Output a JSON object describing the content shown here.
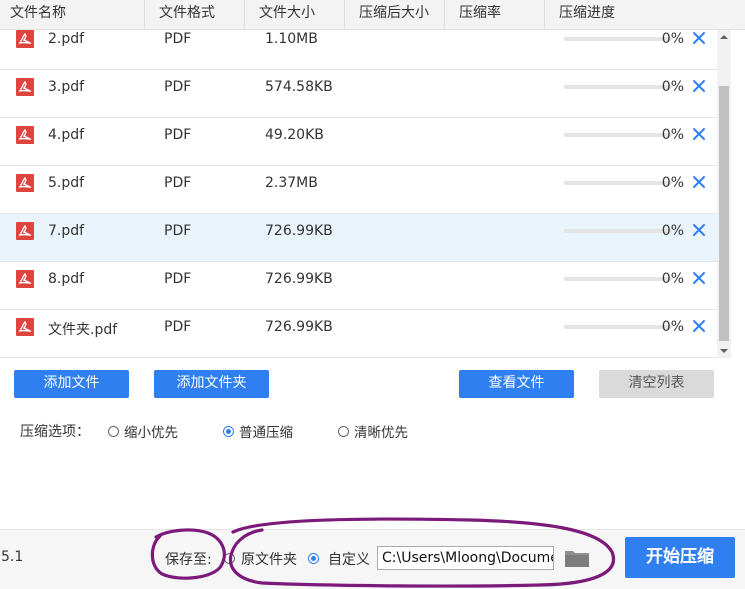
{
  "table": {
    "columns": [
      "文件名称",
      "文件格式",
      "文件大小",
      "压缩后大小",
      "压缩率",
      "压缩进度"
    ],
    "rows": [
      {
        "name": "2.pdf",
        "format": "PDF",
        "size": "1.10MB",
        "compressed_size": "",
        "ratio": "",
        "progress": 0,
        "progress_text": "0%"
      },
      {
        "name": "3.pdf",
        "format": "PDF",
        "size": "574.58KB",
        "compressed_size": "",
        "ratio": "",
        "progress": 0,
        "progress_text": "0%"
      },
      {
        "name": "4.pdf",
        "format": "PDF",
        "size": "49.20KB",
        "compressed_size": "",
        "ratio": "",
        "progress": 0,
        "progress_text": "0%"
      },
      {
        "name": "5.pdf",
        "format": "PDF",
        "size": "2.37MB",
        "compressed_size": "",
        "ratio": "",
        "progress": 0,
        "progress_text": "0%"
      },
      {
        "name": "7.pdf",
        "format": "PDF",
        "size": "726.99KB",
        "compressed_size": "",
        "ratio": "",
        "progress": 0,
        "progress_text": "0%",
        "selected": true
      },
      {
        "name": "8.pdf",
        "format": "PDF",
        "size": "726.99KB",
        "compressed_size": "",
        "ratio": "",
        "progress": 0,
        "progress_text": "0%"
      },
      {
        "name": "文件夹.pdf",
        "format": "PDF",
        "size": "726.99KB",
        "compressed_size": "",
        "ratio": "",
        "progress": 0,
        "progress_text": "0%"
      }
    ],
    "row_icon": "pdf-file-icon",
    "remove_icon": "close-icon"
  },
  "toolbar": {
    "add_file": "添加文件",
    "add_folder": "添加文件夹",
    "view_files": "查看文件",
    "clear_list": "清空列表"
  },
  "compression": {
    "label": "压缩选项：",
    "options": [
      {
        "label": "缩小优先",
        "selected": false
      },
      {
        "label": "普通压缩",
        "selected": true
      },
      {
        "label": "清晰优先",
        "selected": false
      }
    ]
  },
  "footer": {
    "version": "5.1",
    "save_label": "保存至:",
    "original_folder": "原文件夹",
    "custom": "自定义",
    "custom_selected": true,
    "path": "C:\\Users\\Mloong\\Documents",
    "folder_icon": "folder-icon",
    "start_button": "开始压缩"
  },
  "colors": {
    "accent": "#2f7ff0",
    "selected_row": "#eaf4fd",
    "remove_icon": "#2f7ff0",
    "pdf_icon": "#e0443e",
    "annotation": "#7b1a7b"
  }
}
